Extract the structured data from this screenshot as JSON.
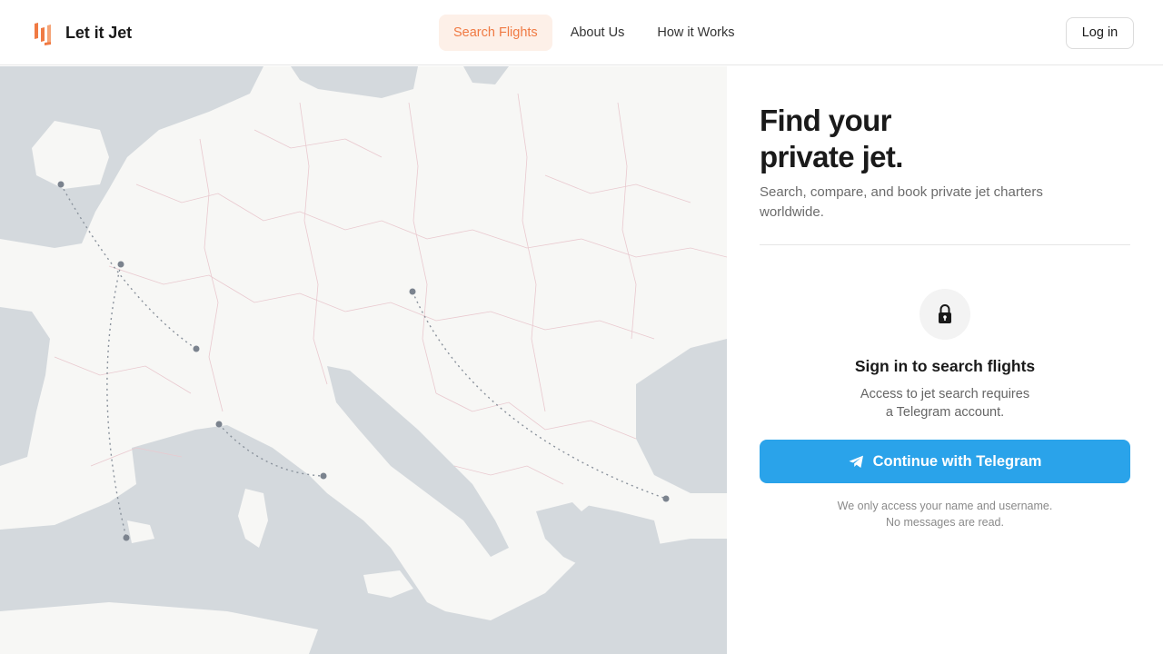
{
  "header": {
    "brand_name": "Let it Jet",
    "nav": [
      {
        "label": "Search Flights",
        "active": true
      },
      {
        "label": "About Us",
        "active": false
      },
      {
        "label": "How it Works",
        "active": false
      }
    ],
    "login_label": "Log in"
  },
  "hero": {
    "title_line1": "Find your",
    "title_line2": "private jet.",
    "subtitle": "Search, compare, and book private jet charters worldwide."
  },
  "signin": {
    "title": "Sign in to search flights",
    "desc_line1": "Access to jet search requires",
    "desc_line2": "a Telegram account.",
    "button_label": "Continue with Telegram",
    "privacy_line1": "We only access your name and username.",
    "privacy_line2": "No messages are read."
  },
  "colors": {
    "brand_orange": "#f07a43",
    "nav_active_bg": "#fdf0e8",
    "telegram_blue": "#2aa3ea",
    "map_land": "#f7f7f5",
    "map_water": "#d4d9dd",
    "map_border": "#e9c9cf",
    "route_color": "#8a929c"
  },
  "icons": {
    "brand": "brand-logo-icon",
    "lock": "lock-icon",
    "telegram": "telegram-plane-icon"
  }
}
